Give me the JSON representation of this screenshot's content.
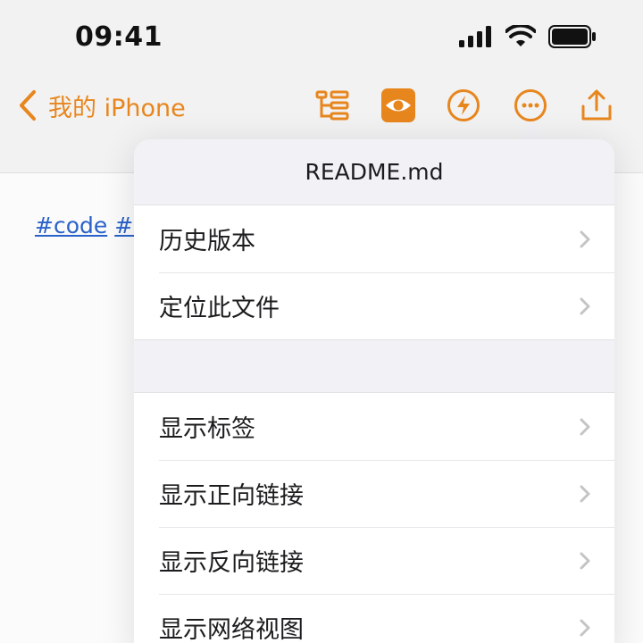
{
  "status_bar": {
    "time": "09:41"
  },
  "nav": {
    "back_label": "我的 iPhone",
    "accent_color": "#e8861e"
  },
  "toolbar": {
    "icons": [
      "outline-icon",
      "preview-eye-icon",
      "lightning-icon",
      "more-icon",
      "share-icon"
    ]
  },
  "content": {
    "tags": [
      "#code",
      "#ic"
    ]
  },
  "popover": {
    "title": "README.md",
    "group1": [
      "历史版本",
      "定位此文件"
    ],
    "group2": [
      "显示标签",
      "显示正向链接",
      "显示反向链接",
      "显示网络视图"
    ]
  }
}
